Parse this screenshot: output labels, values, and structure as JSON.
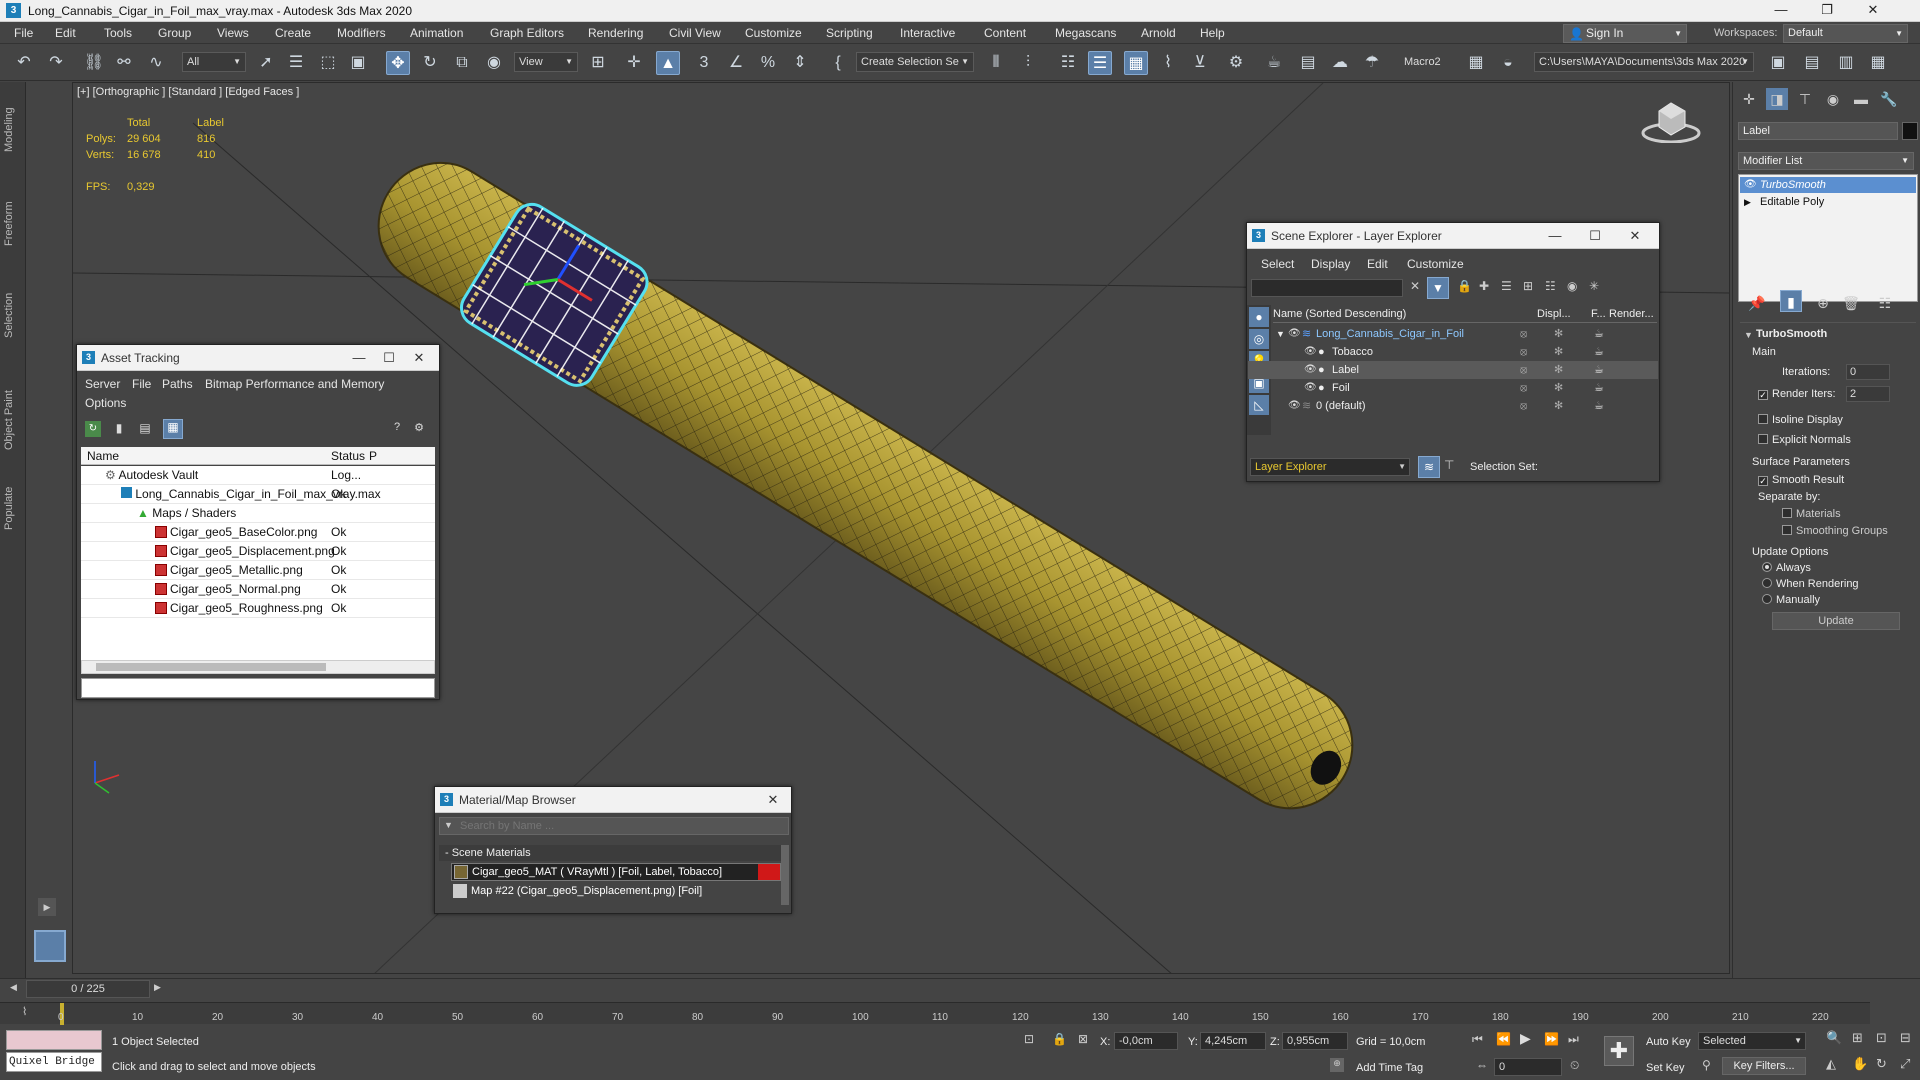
{
  "window": {
    "title": "Long_Cannabis_Cigar_in_Foil_max_vray.max - Autodesk 3ds Max 2020",
    "app_icon": "3",
    "minimize": "—",
    "maximize": "❐",
    "close": "✕"
  },
  "menu": [
    "File",
    "Edit",
    "Tools",
    "Group",
    "Views",
    "Create",
    "Modifiers",
    "Animation",
    "Graph Editors",
    "Rendering",
    "Civil View",
    "Customize",
    "Scripting",
    "Interactive",
    "Content",
    "Megascans",
    "Arnold",
    "Help"
  ],
  "account": {
    "sign_in": "Sign In",
    "workspaces_label": "Workspaces:",
    "workspace": "Default"
  },
  "toolbar": {
    "selection_filter": "All",
    "ref_coord": "View",
    "selection_set": "Create Selection Se",
    "macro": "Macro2",
    "project_path": "C:\\Users\\MAYA\\Documents\\3ds Max 2020"
  },
  "ribbon_tabs": [
    "Modeling",
    "Freeform",
    "Selection",
    "Object Paint",
    "Populate"
  ],
  "viewport": {
    "label": "[+] [Orthographic ] [Standard ] [Edged Faces ]",
    "stats": {
      "col_total": "Total",
      "col_label": "Label",
      "polys_label": "Polys:",
      "polys_total": "29 604",
      "polys_sel": "816",
      "verts_label": "Verts:",
      "verts_total": "16 678",
      "verts_sel": "410",
      "fps_label": "FPS:",
      "fps": "0,329"
    }
  },
  "asset_tracking": {
    "title": "Asset Tracking",
    "menu": [
      "Server",
      "File",
      "Paths",
      "Bitmap Performance and Memory",
      "Options"
    ],
    "columns": [
      "Name",
      "Status",
      "P"
    ],
    "rows": [
      {
        "name": "Autodesk Vault",
        "status": "Log..."
      },
      {
        "name": "Long_Cannabis_Cigar_in_Foil_max_vray.max",
        "status": "Ok"
      },
      {
        "name": "Maps / Shaders",
        "status": ""
      },
      {
        "name": "Cigar_geo5_BaseColor.png",
        "status": "Ok"
      },
      {
        "name": "Cigar_geo5_Displacement.png",
        "status": "Ok"
      },
      {
        "name": "Cigar_geo5_Metallic.png",
        "status": "Ok"
      },
      {
        "name": "Cigar_geo5_Normal.png",
        "status": "Ok"
      },
      {
        "name": "Cigar_geo5_Roughness.png",
        "status": "Ok"
      }
    ]
  },
  "scene_explorer": {
    "title": "Scene Explorer - Layer Explorer",
    "menu": [
      "Select",
      "Display",
      "Edit",
      "Customize"
    ],
    "columns": {
      "name": "Name (Sorted Descending)",
      "display": "Displ...",
      "freeze": "F...",
      "render": "Render..."
    },
    "rows": [
      {
        "name": "Long_Cannabis_Cigar_in_Foil"
      },
      {
        "name": "Tobacco"
      },
      {
        "name": "Label"
      },
      {
        "name": "Foil"
      },
      {
        "name": "0 (default)"
      }
    ],
    "footer_dropdown": "Layer Explorer",
    "selection_set": "Selection Set:"
  },
  "material_browser": {
    "title": "Material/Map Browser",
    "search_placeholder": "Search by Name ...",
    "group": "- Scene Materials",
    "items": [
      "Cigar_geo5_MAT  ( VRayMtl )  [Foil, Label, Tobacco]",
      "Map #22 (Cigar_geo5_Displacement.png) [Foil]"
    ]
  },
  "command_panel": {
    "object_name": "Label",
    "modifier_list": "Modifier List",
    "stack": [
      "TurboSmooth",
      "Editable Poly"
    ],
    "rollout_title": "TurboSmooth",
    "main": "Main",
    "iterations_label": "Iterations:",
    "iterations": "0",
    "render_iters_label": "Render Iters:",
    "render_iters": "2",
    "isoline": "Isoline Display",
    "explicit_normals": "Explicit Normals",
    "surface_params": "Surface Parameters",
    "smooth_result": "Smooth Result",
    "separate_by": "Separate by:",
    "materials": "Materials",
    "smoothing_groups": "Smoothing Groups",
    "update_options": "Update Options",
    "always": "Always",
    "when_rendering": "When Rendering",
    "manually": "Manually",
    "update_button": "Update"
  },
  "timeline": {
    "frame": "0 / 225",
    "ticks": [
      "0",
      "10",
      "20",
      "30",
      "40",
      "50",
      "60",
      "70",
      "80",
      "90",
      "100",
      "110",
      "120",
      "130",
      "140",
      "150",
      "160",
      "170",
      "180",
      "190",
      "200",
      "210",
      "220"
    ]
  },
  "status": {
    "quixel": "Quixel Bridge",
    "selected": "1 Object Selected",
    "prompt": "Click and drag to select and move objects",
    "x_label": "X:",
    "x": "-0,0cm",
    "y_label": "Y:",
    "y": "4,245cm",
    "z_label": "Z:",
    "z": "0,955cm",
    "grid": "Grid = 10,0cm",
    "add_time_tag": "Add Time Tag",
    "auto_key": "Auto Key",
    "selected_dropdown": "Selected",
    "set_key": "Set Key",
    "key_filters": "Key Filters...",
    "frame_field": "0"
  }
}
